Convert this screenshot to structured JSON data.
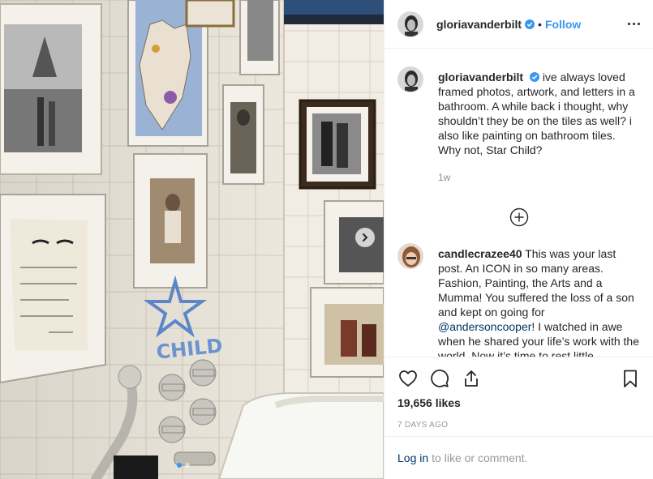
{
  "header": {
    "username": "gloriavanderbilt",
    "separator": "•",
    "follow_label": "Follow"
  },
  "caption": {
    "username": "gloriavanderbilt",
    "text": "ive always loved framed photos, artwork, and letters in a bathroom. A while back i thought, why shouldn’t they be on the tiles as well? i also like painting on bathroom tiles. Why not, Star Child?",
    "time": "1w"
  },
  "comments": [
    {
      "username": "candlecrazee40",
      "text_before": "This was your last post. An ICON in so many areas. Fashion, Painting, the Arts and a Mumma! You suffered the loss of a son and kept on going for",
      "mention": "@andersoncooper",
      "text_after": "! I watched in awe when he shared your life’s work with the world. Now it’s time to rest little"
    }
  ],
  "stats": {
    "likes": "19,656 likes",
    "date": "7 DAYS AGO"
  },
  "login": {
    "link": "Log in",
    "rest": "to like or comment."
  },
  "photo": {
    "painted_text": "CHILD",
    "carousel_count": 2,
    "carousel_active": 0
  },
  "icons": [
    "heart-icon",
    "comment-icon",
    "share-icon",
    "bookmark-icon",
    "verified-badge-icon",
    "more-options-icon",
    "load-more-icon",
    "chevron-right-icon"
  ],
  "colors": {
    "accent": "#3897f0",
    "link": "#003569",
    "muted": "#8e8e8e"
  }
}
